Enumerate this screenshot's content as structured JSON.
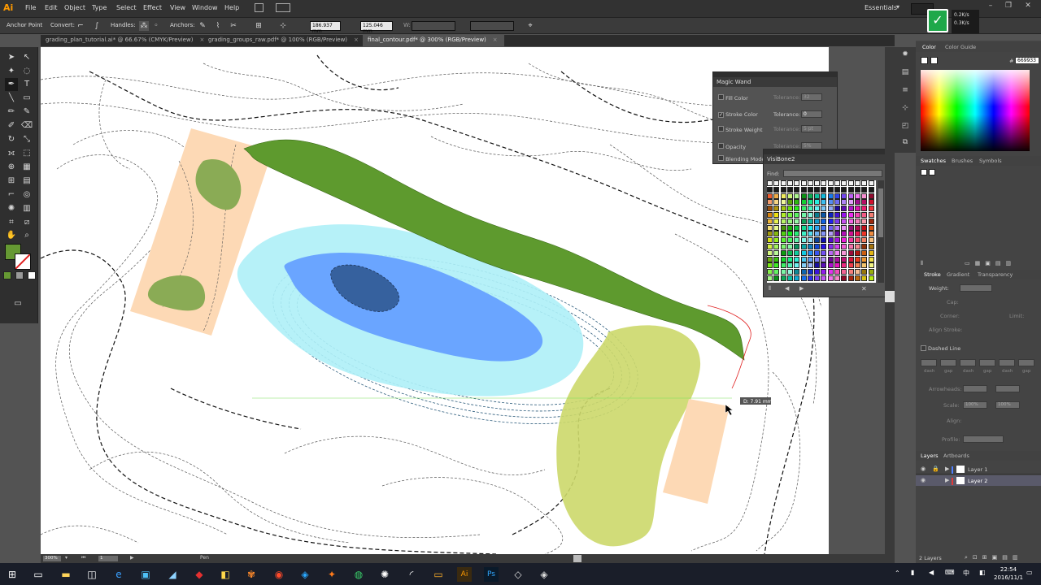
{
  "app": {
    "logo": "Ai",
    "workspace": "Essentials",
    "menus": [
      "File",
      "Edit",
      "Object",
      "Type",
      "Select",
      "Effect",
      "View",
      "Window",
      "Help"
    ],
    "net_speed_up": "0.2K/s",
    "net_speed_down": "0.3K/s"
  },
  "controlbar": {
    "tool_name": "Anchor Point",
    "convert_label": "Convert:",
    "handles_label": "Handles:",
    "anchors_label": "Anchors:",
    "x_value": "186.937 mm",
    "y_value": "125.046 mm",
    "w_label": "W:"
  },
  "tabs": [
    {
      "label": "grading_plan_tutorial.ai* @ 66.67% (CMYK/Preview)",
      "active": false
    },
    {
      "label": "grading_groups_raw.pdf* @ 100% (RGB/Preview)",
      "active": false
    },
    {
      "label": "final_contour.pdf* @ 300% (RGB/Preview)",
      "active": true
    }
  ],
  "canvas": {
    "measure_label": "D: 7.91 mm"
  },
  "magic_wand": {
    "title": "Magic Wand",
    "rows": [
      {
        "label": "Fill Color",
        "checked": false,
        "tol_label": "Tolerance:",
        "tol_value": "32"
      },
      {
        "label": "Stroke Color",
        "checked": true,
        "tol_label": "Tolerance:",
        "tol_value": "0"
      },
      {
        "label": "Stroke Weight",
        "checked": false,
        "tol_label": "Tolerance:",
        "tol_value": "5 pt"
      },
      {
        "label": "Opacity",
        "checked": false,
        "tol_label": "Tolerance:",
        "tol_value": "5%"
      },
      {
        "label": "Blending Mode",
        "checked": false,
        "tol_label": "",
        "tol_value": ""
      }
    ]
  },
  "visibone": {
    "title": "VisiBone2",
    "find_label": "Find:"
  },
  "color_panel": {
    "tabs": [
      "Color",
      "Color Guide"
    ],
    "hex_symbol": "#",
    "hex_value": "669933"
  },
  "swatches_panel": {
    "tabs": [
      "Swatches",
      "Brushes",
      "Symbols"
    ]
  },
  "stroke_panel": {
    "tabs": [
      "Stroke",
      "Gradient",
      "Transparency"
    ],
    "weight_label": "Weight:",
    "cap_label": "Cap:",
    "corner_label": "Corner:",
    "limit_label": "Limit:",
    "align_label": "Align Stroke:",
    "dashed_label": "Dashed Line",
    "dash_cells": [
      "dash",
      "gap",
      "dash",
      "gap",
      "dash",
      "gap"
    ],
    "arrowheads_label": "Arrowheads:",
    "scale_label": "Scale:",
    "scale_value1": "100%",
    "scale_value2": "100%",
    "align2_label": "Align:",
    "profile_label": "Profile:"
  },
  "layers_panel": {
    "tabs": [
      "Layers",
      "Artboards"
    ],
    "layers": [
      {
        "name": "Layer 1",
        "color": "#4f80ff"
      },
      {
        "name": "Layer 2",
        "color": "#e03a3a"
      }
    ],
    "count": "2 Layers"
  },
  "status": {
    "zoom": "300%",
    "page": "1",
    "tool": "Pen"
  },
  "taskbar": {
    "time": "22:54",
    "date": "2016/11/1"
  },
  "colors": {
    "fill_swatch": "#669933",
    "accent": "#ff9a00"
  }
}
